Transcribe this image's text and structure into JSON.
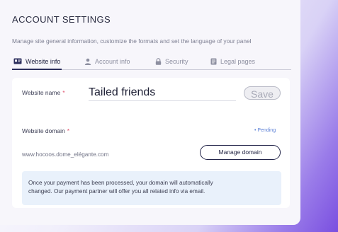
{
  "page": {
    "title": "ACCOUNT SETTINGS",
    "subtitle": "Manage site general information, customize the formats and set the language of your panel"
  },
  "tabs": [
    {
      "label": "Website info",
      "icon": "id-card-icon",
      "active": true
    },
    {
      "label": "Account info",
      "icon": "user-icon",
      "active": false
    },
    {
      "label": "Security",
      "icon": "lock-icon",
      "active": false
    },
    {
      "label": "Legal pages",
      "icon": "document-icon",
      "active": false
    }
  ],
  "website_name": {
    "label": "Website name",
    "required_mark": "*",
    "value": "Tailed friends",
    "save_label": "Save"
  },
  "website_domain": {
    "label": "Website domain",
    "required_mark": "*",
    "status": "• Pending",
    "domain": "www.hocoos.dome_elégante.com",
    "manage_label": "Manage domain"
  },
  "notice": {
    "text_line1": "Once your payment has been processed, your domain will automatically",
    "text_line2": "changed. Our payment partner will offer you all related info via email."
  },
  "colors": {
    "background_accent": "#7a4fe0",
    "status_pending": "#5a7fd6",
    "required": "#e0506b",
    "notice_bg": "#e9f1fb"
  }
}
